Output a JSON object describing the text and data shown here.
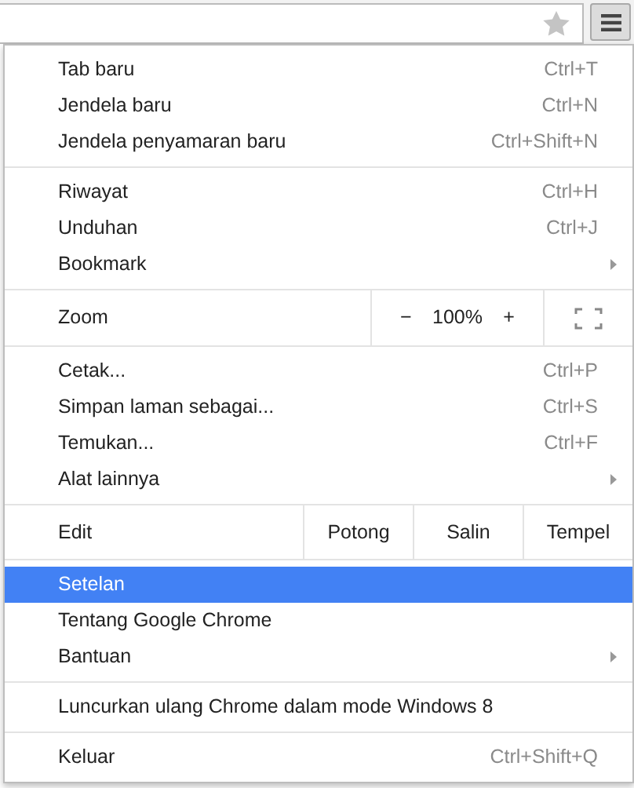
{
  "toolbar": {
    "menu_button": {
      "selected": true
    }
  },
  "menu": [
    {
      "kind": "items",
      "items": [
        {
          "label": "Tab baru",
          "shortcut": "Ctrl+T",
          "submenu": false,
          "selected": false
        },
        {
          "label": "Jendela baru",
          "shortcut": "Ctrl+N",
          "submenu": false,
          "selected": false
        },
        {
          "label": "Jendela penyamaran baru",
          "shortcut": "Ctrl+Shift+N",
          "submenu": false,
          "selected": false
        }
      ]
    },
    {
      "kind": "items",
      "items": [
        {
          "label": "Riwayat",
          "shortcut": "Ctrl+H",
          "submenu": false,
          "selected": false
        },
        {
          "label": "Unduhan",
          "shortcut": "Ctrl+J",
          "submenu": false,
          "selected": false
        },
        {
          "label": "Bookmark",
          "submenu": true,
          "selected": false
        }
      ]
    },
    {
      "kind": "zoom",
      "label": "Zoom",
      "minus": "−",
      "value": "100%",
      "plus": "+"
    },
    {
      "kind": "items",
      "items": [
        {
          "label": "Cetak...",
          "shortcut": "Ctrl+P",
          "submenu": false,
          "selected": false
        },
        {
          "label": "Simpan laman sebagai...",
          "shortcut": "Ctrl+S",
          "submenu": false,
          "selected": false
        },
        {
          "label": "Temukan...",
          "shortcut": "Ctrl+F",
          "submenu": false,
          "selected": false
        },
        {
          "label": "Alat lainnya",
          "submenu": true,
          "selected": false
        }
      ]
    },
    {
      "kind": "edit",
      "label": "Edit",
      "buttons": [
        "Potong",
        "Salin",
        "Tempel"
      ]
    },
    {
      "kind": "items",
      "items": [
        {
          "label": "Setelan",
          "submenu": false,
          "selected": true
        },
        {
          "label": "Tentang Google Chrome",
          "submenu": false,
          "selected": false
        },
        {
          "label": "Bantuan",
          "submenu": true,
          "selected": false
        }
      ]
    },
    {
      "kind": "items",
      "items": [
        {
          "label": "Luncurkan ulang Chrome dalam mode Windows 8",
          "submenu": false,
          "selected": false
        }
      ]
    },
    {
      "kind": "items",
      "items": [
        {
          "label": "Keluar",
          "shortcut": "Ctrl+Shift+Q",
          "submenu": false,
          "selected": false
        }
      ]
    }
  ]
}
